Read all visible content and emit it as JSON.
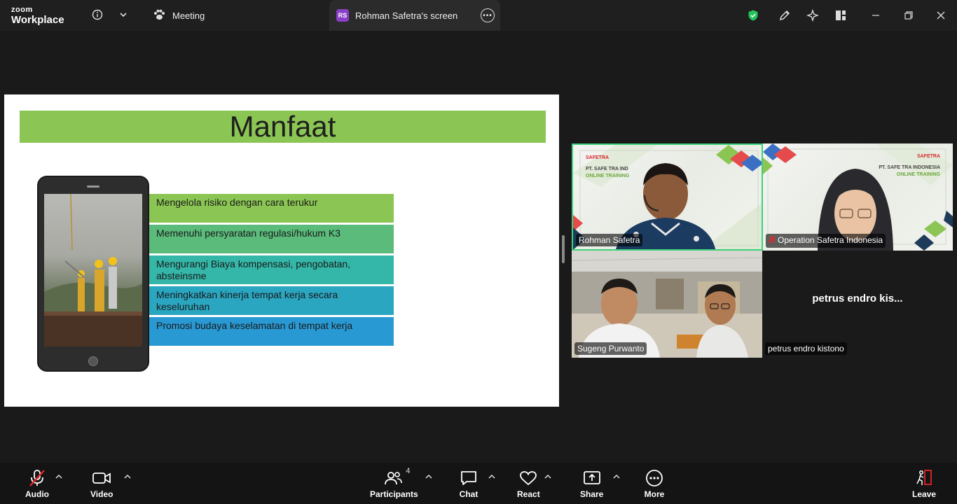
{
  "app": {
    "brand_small": "zoom",
    "brand_large": "Workplace"
  },
  "tabs": [
    {
      "label": "Meeting"
    },
    {
      "label": "Rohman Safetra's screen",
      "badge": "RS"
    }
  ],
  "slide": {
    "title": "Manfaat",
    "items": [
      {
        "text": "Mengelola risiko dengan cara terukur",
        "color": "#8bc553"
      },
      {
        "text": "Memenuhi persyaratan regulasi/hukum K3",
        "color": "#5abb7b"
      },
      {
        "text": "Mengurangi Biaya kompensasi, pengobatan, absteinsme",
        "color": "#34b7a8"
      },
      {
        "text": "Meningkatkan kinerja tempat kerja secara keseluruhan",
        "color": "#2aa6c1"
      },
      {
        "text": "Promosi budaya keselamatan di tempat kerja",
        "color": "#2999d3"
      }
    ]
  },
  "participants_tiles": [
    {
      "name": "Rohman Safetra",
      "logo_brand": "SAFETRA",
      "logo_line1": "PT. SAFE TRA IND",
      "logo_line2": "ONLINE TRAINING"
    },
    {
      "name": "Operation Safetra Indonesia",
      "logo_brand": "SAFETRA",
      "logo_line1": "PT. SAFE TRA INDONESIA",
      "logo_line2": "ONLINE TRAINING"
    },
    {
      "name": "Sugeng Purwanto"
    },
    {
      "name": "petrus endro kistono",
      "display": "petrus endro kis..."
    }
  ],
  "toolbar": {
    "audio": "Audio",
    "video": "Video",
    "participants": "Participants",
    "participants_count": "4",
    "chat": "Chat",
    "react": "React",
    "share": "Share",
    "more": "More",
    "leave": "Leave"
  },
  "colors": {
    "active_speaker_border": "#3cd27a",
    "leave_red": "#e5252a",
    "security_green": "#23c35a"
  }
}
